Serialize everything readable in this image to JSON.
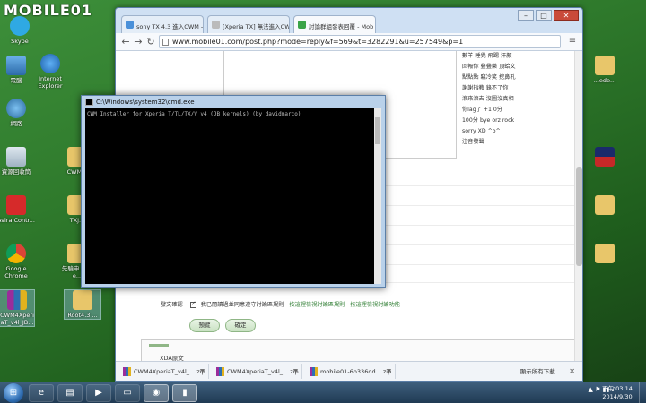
{
  "watermark": "MOBILE01",
  "desktop": {
    "left_icons": [
      {
        "label": "Skype"
      },
      {
        "label": "電腦"
      },
      {
        "label": "Internet Explorer"
      },
      {
        "label": "網路"
      },
      {
        "label": "資源回收筒"
      },
      {
        "label": "Avira Contr..."
      },
      {
        "label": "Google Chrome"
      },
      {
        "label": "CWM4Xperi aT_v4l_JB..."
      }
    ],
    "mid_icons": [
      {
        "label": "CWM..."
      },
      {
        "label": "TXJ..."
      },
      {
        "label": "先驗申... —e..."
      },
      {
        "label": "Root4.3 ..."
      }
    ],
    "right_icons": [
      {
        "label": "...ede..."
      }
    ]
  },
  "browser": {
    "tabs": [
      {
        "label": "sony TX 4.3 進入CWM -"
      },
      {
        "label": "[Xperia TX] 無法進入CW"
      },
      {
        "label": "討論群組發表回覆 - Mob"
      }
    ],
    "url": "www.mobile01.com/post.php?mode=reply&f=569&t=3282291&u=257549&p=1",
    "emoticons": [
      "數羊  睡覺  飛踢  汗顏",
      "回報你  叠叠樂  頂蛤文",
      "點點點  竊冷笑  挖鼻孔",
      "謝謝指教  錄不了你",
      "滾來滾去  沒圖沒真相",
      "你lag了  +1  0分",
      "100分  bye  orz  rock",
      "sorry  XD  ^o^",
      "注音發聲"
    ],
    "confirm_label": "發文確認",
    "confirm_text": "我已閱讀過並同意遵守討論區規則",
    "confirm_link1": "按這裡檢視討論區規則",
    "confirm_link2": "按這裡檢視討論功能",
    "preview_button": "預覽",
    "submit_button": "確定",
    "preview_title": "XDA原文",
    "downloads": [
      {
        "name": "CWM4XperiaT_v4l_....zip"
      },
      {
        "name": "CWM4XperiaT_v4l_....zip"
      },
      {
        "name": "mobile01-6b336dd....zip"
      }
    ],
    "show_all": "顯示所有下載..."
  },
  "cmd": {
    "title": "C:\\Windows\\system32\\cmd.exe",
    "output": "CWM Installer for Xperia T/TL/TX/V v4 (JB kernels) (by davidmarco)"
  },
  "taskbar": {
    "clock_time": "下午 03:14",
    "clock_date": "2014/9/30"
  },
  "colors": {
    "desktop_green": "#2f7a2c",
    "cmd_bg": "#000000",
    "taskbar": "#203a53",
    "accent_green": "#8fb686"
  }
}
